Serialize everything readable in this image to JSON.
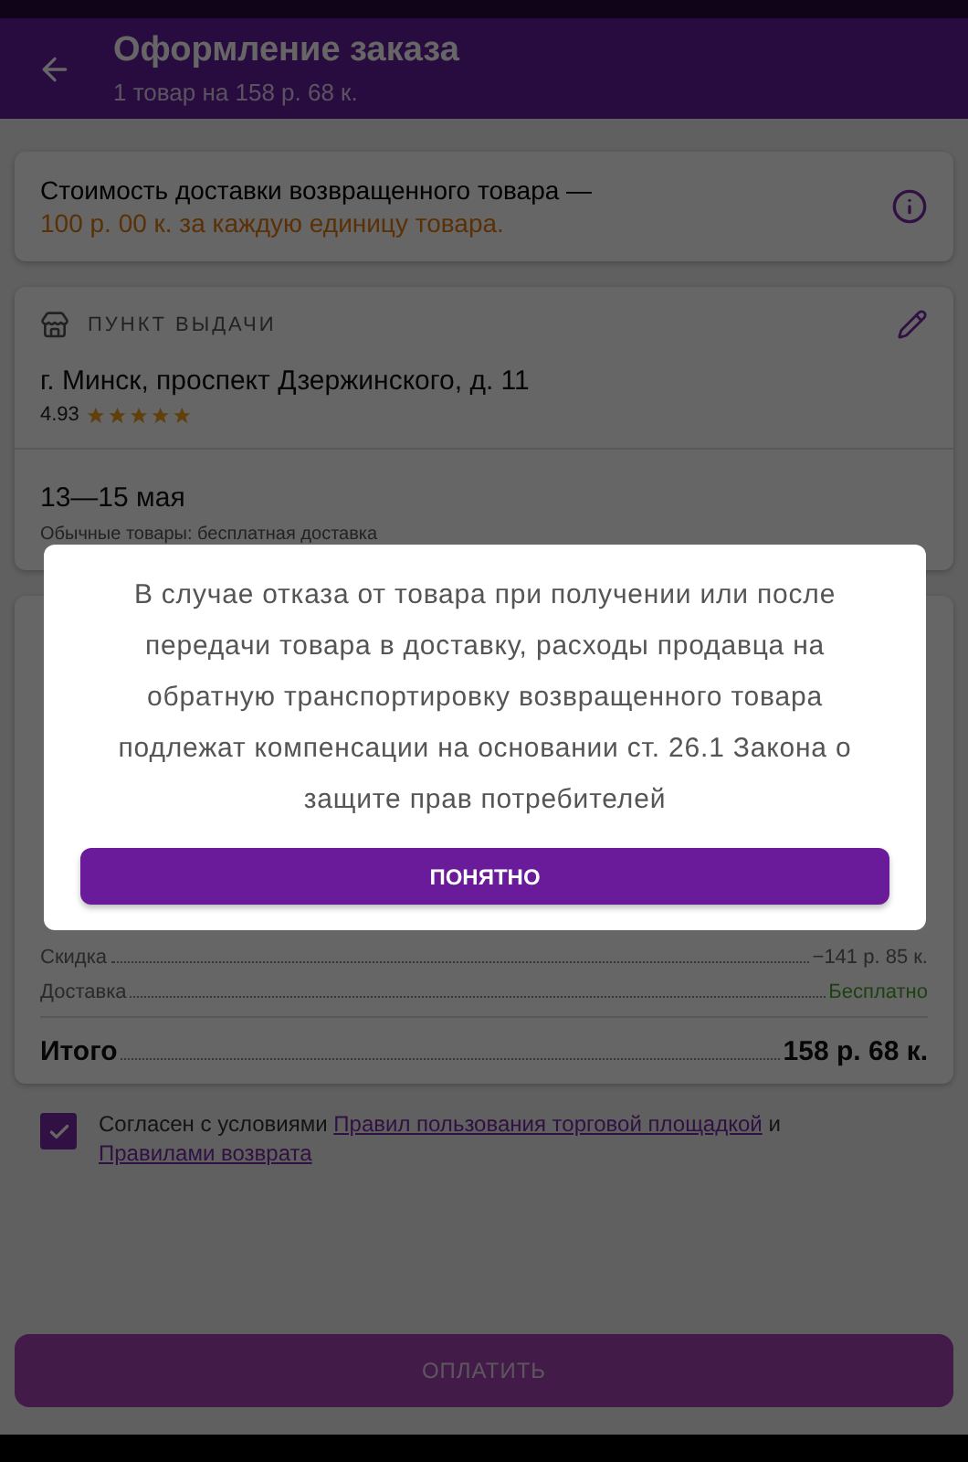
{
  "header": {
    "title": "Оформление заказа",
    "subtitle": "1 товар на 158 р. 68 к."
  },
  "notice": {
    "text": "Стоимость доставки возвращенного товара —",
    "highlight": "100 р. 00 к. за каждую единицу товара."
  },
  "pickup": {
    "heading": "ПУНКТ ВЫДАЧИ",
    "address": "г. Минск, проспект Дзержинского, д. 11",
    "rating": "4.93",
    "stars": 5,
    "dates": "13—15 мая",
    "note": "Обычные товары: бесплатная доставка"
  },
  "summary": {
    "rows": [
      {
        "label": "Скидка",
        "value": "−141 р. 85 к.",
        "kind": "plain"
      },
      {
        "label": "Доставка",
        "value": "Бесплатно",
        "kind": "free"
      }
    ],
    "total": {
      "label": "Итого",
      "value": "158 р. 68 к."
    }
  },
  "agreement": {
    "checked": true,
    "parts": [
      {
        "kind": "text",
        "text": "Согласен с условиями "
      },
      {
        "kind": "link",
        "text": "Правил пользования торговой площадкой"
      },
      {
        "kind": "text",
        "text": " и "
      },
      {
        "kind": "link",
        "text": "Правилами возврата"
      }
    ]
  },
  "pay_button": "ОПЛАТИТЬ",
  "dialog": {
    "message": "В случае отказа от товара при получении или после передачи товара в доставку, расходы продавца на обратную транспортировку возвращенного товара подлежат компенсации на основании ст. 26.1 Закона о защите прав потребителей",
    "button": "ПОНЯТНО"
  }
}
